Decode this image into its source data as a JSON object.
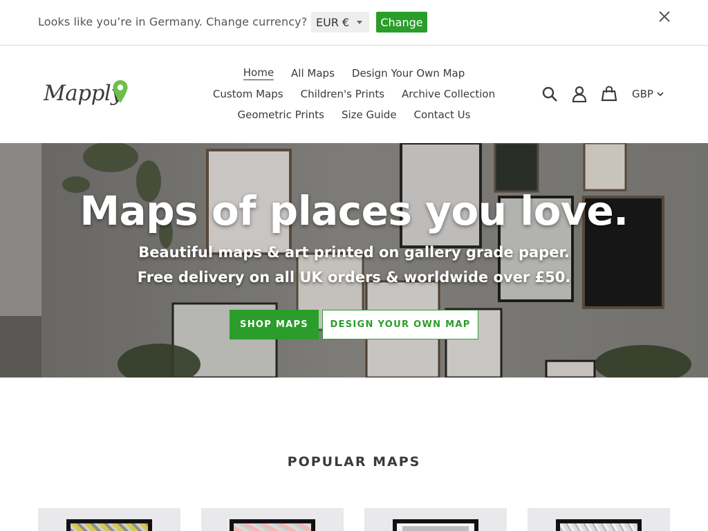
{
  "currency_bar": {
    "message": "Looks like you’re in Germany. Change currency?",
    "selected_currency": "EUR €",
    "change_label": "Change",
    "close_icon": "close-icon"
  },
  "header": {
    "logo_text": "Mapply",
    "nav_rows": [
      [
        "Home",
        "All Maps",
        "Design Your Own Map"
      ],
      [
        "Custom Maps",
        "Children's Prints",
        "Archive Collection"
      ],
      [
        "Geometric Prints",
        "Size Guide",
        "Contact Us"
      ]
    ],
    "active_nav": "Home",
    "icons": [
      "search-icon",
      "account-icon",
      "cart-icon"
    ],
    "currency_selector": "GBP"
  },
  "hero": {
    "title": "Maps of places you love.",
    "subtitle_line1": "Beautiful maps & art printed on gallery grade paper.",
    "subtitle_line2": "Free delivery on all UK orders & worldwide over £50.",
    "primary_button": "SHOP MAPS",
    "secondary_button": "DESIGN YOUR OWN MAP"
  },
  "popular": {
    "title": "POPULAR MAPS"
  },
  "colors": {
    "accent": "#2a9d2a",
    "text": "#3a3a3a",
    "logo_pin": "#6cc04a"
  }
}
